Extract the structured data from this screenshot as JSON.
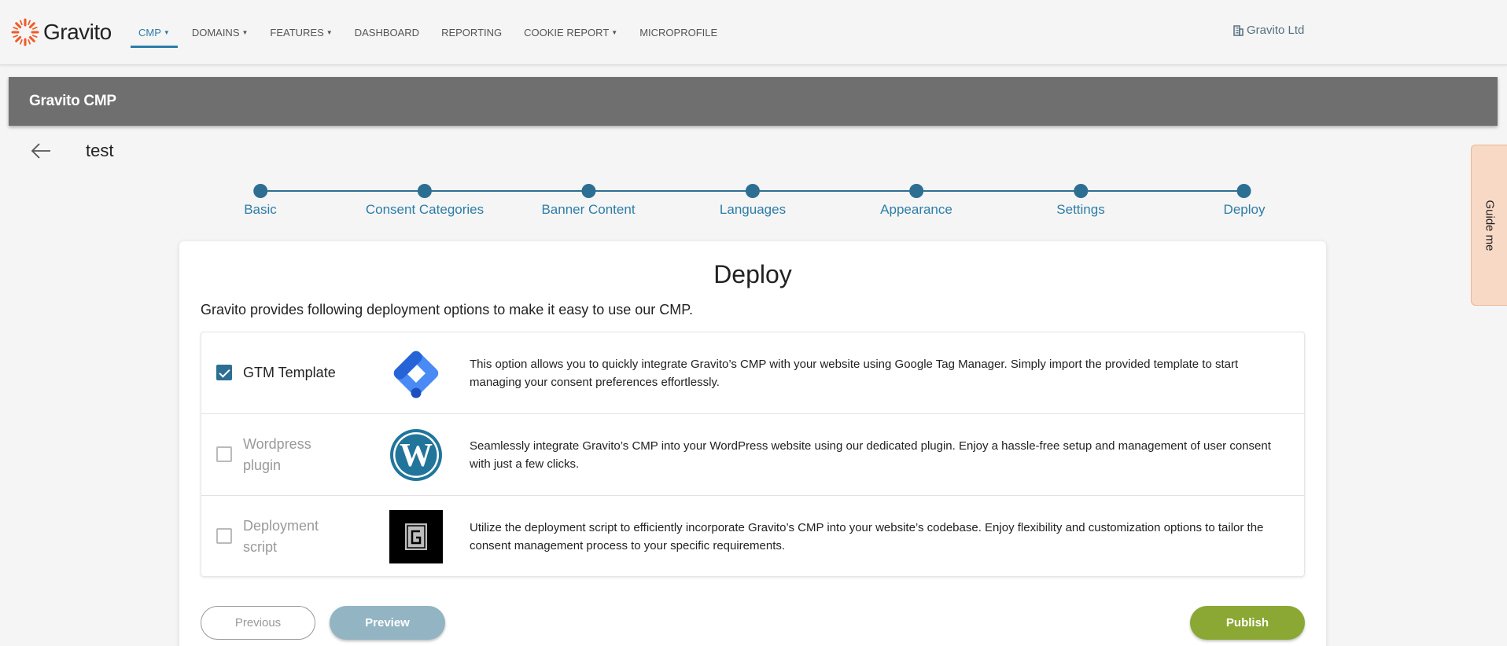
{
  "brand": {
    "name": "Gravito"
  },
  "nav": {
    "items": [
      {
        "label": "CMP",
        "dropdown": true,
        "active": true
      },
      {
        "label": "DOMAINS",
        "dropdown": true
      },
      {
        "label": "FEATURES",
        "dropdown": true
      },
      {
        "label": "DASHBOARD"
      },
      {
        "label": "REPORTING"
      },
      {
        "label": "COOKIE REPORT",
        "dropdown": true
      },
      {
        "label": "MICROPROFILE"
      }
    ],
    "org_name": "Gravito Ltd",
    "org_icon": "building-icon"
  },
  "header": {
    "title": "Gravito CMP"
  },
  "page": {
    "record_name": "test",
    "back_icon": "arrow-left-icon"
  },
  "stepper": {
    "steps": [
      "Basic",
      "Consent Categories",
      "Banner Content",
      "Languages",
      "Appearance",
      "Settings",
      "Deploy"
    ],
    "current": "Deploy"
  },
  "guide": {
    "label": "Guide me"
  },
  "deploy": {
    "title": "Deploy",
    "description": "Gravito provides following deployment options to make it easy to use our CMP.",
    "options": [
      {
        "name": "GTM Template",
        "checked": true,
        "logo": "google-tag-manager-icon",
        "text": "This option allows you to quickly integrate Gravito’s CMP with your website using Google Tag Manager. Simply import the provided template to start managing your consent preferences effortlessly."
      },
      {
        "name": "Wordpress plugin",
        "checked": false,
        "logo": "wordpress-icon",
        "text": "Seamlessly integrate Gravito’s CMP into your WordPress website using our dedicated plugin. Enjoy a hassle-free setup and management of user consent with just a few clicks."
      },
      {
        "name": "Deployment script",
        "checked": false,
        "logo": "gravito-script-icon",
        "text": "Utilize the deployment script to efficiently incorporate Gravito’s CMP into your website’s codebase. Enjoy flexibility and customization options to tailor the consent management process to your specific requirements."
      }
    ]
  },
  "buttons": {
    "previous": "Previous",
    "preview": "Preview",
    "publish": "Publish"
  },
  "colors": {
    "primary": "#2d6f93",
    "publish": "#8aa833",
    "preview": "#92b4c3",
    "header": "#6f6f6f",
    "brand_orange": "#f05a28"
  }
}
